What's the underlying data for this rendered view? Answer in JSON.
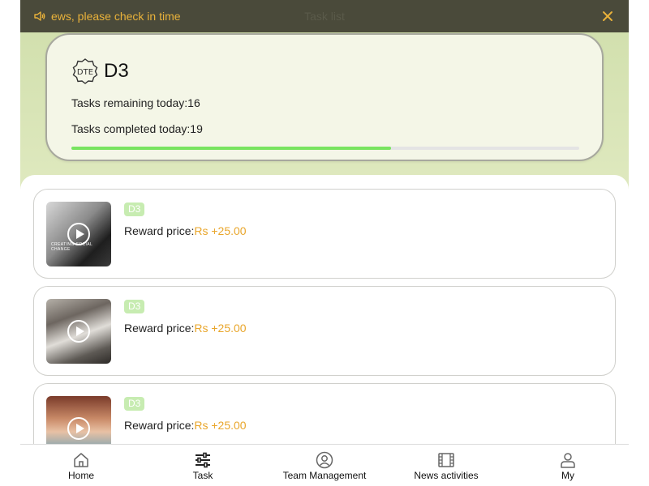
{
  "notice": {
    "text": "ews, please check in time",
    "faint_title": "Task list",
    "icons": {
      "speaker": "speaker-icon",
      "close": "close-icon"
    },
    "text_color": "#e9b23a"
  },
  "summary": {
    "level": "D3",
    "badge_icon": "dte-badge-icon",
    "remaining_text": "Tasks remaining today:16",
    "completed_text": "Tasks completed today:19",
    "progress_fraction": 0.63,
    "progress_color": "#78e460"
  },
  "tasks": [
    {
      "tag": "D3",
      "reward_label": "Reward price:",
      "reward_value": "Rs +25.00",
      "thumb_caption": "CREATING SOCIAL CHANGE"
    },
    {
      "tag": "D3",
      "reward_label": "Reward price:",
      "reward_value": "Rs +25.00"
    },
    {
      "tag": "D3",
      "reward_label": "Reward price:",
      "reward_value": "Rs +25.00"
    }
  ],
  "tabbar": {
    "items": [
      {
        "label": "Home",
        "icon": "home-icon"
      },
      {
        "label": "Task",
        "icon": "sliders-icon"
      },
      {
        "label": "Team Management",
        "icon": "user-circle-icon"
      },
      {
        "label": "News activities",
        "icon": "film-icon"
      },
      {
        "label": "My",
        "icon": "person-icon"
      }
    ],
    "active_index": 1
  }
}
